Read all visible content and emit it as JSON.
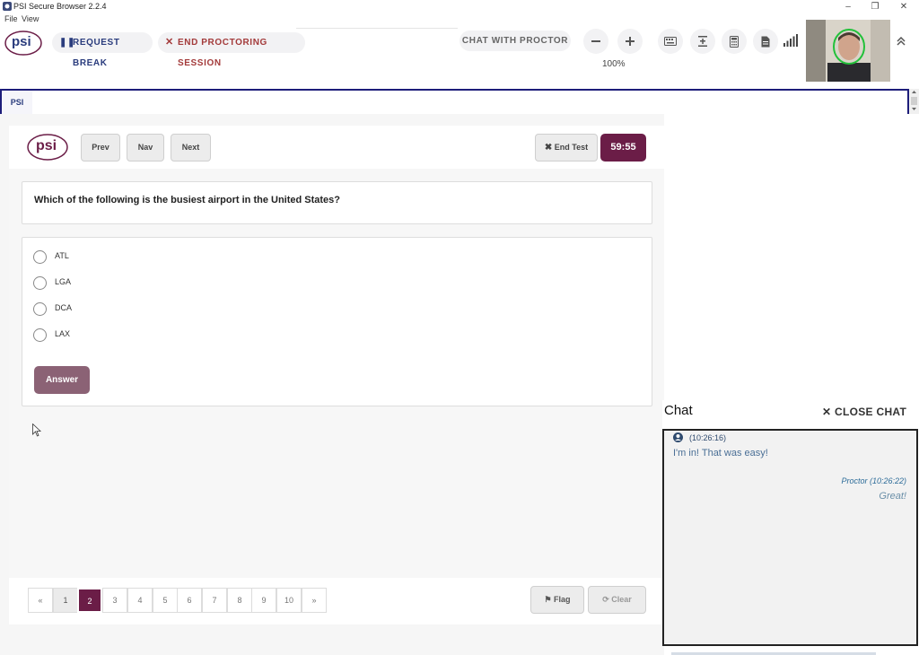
{
  "window": {
    "title": "PSI Secure Browser 2.2.4"
  },
  "menu": [
    "File",
    "View"
  ],
  "toolbar": {
    "logo": "psi",
    "request_break": "REQUEST BREAK",
    "end_session": "END PROCTORING SESSION",
    "chat_proctor": "CHAT WITH PROCTOR",
    "zoom": "100%",
    "icons": [
      "zoom-out-icon",
      "zoom-in-icon",
      "keyboard-icon",
      "text-height-icon",
      "calculator-icon",
      "document-icon",
      "signal-icon",
      "collapse-icon"
    ]
  },
  "tabs": {
    "active": "PSI"
  },
  "exam": {
    "logo": "psi",
    "prev": "Prev",
    "nav": "Nav",
    "next": "Next",
    "end_test": "End Test",
    "timer": "59:55",
    "question": "Which of the following is the busiest airport in the United States?",
    "options": [
      "ATL",
      "LGA",
      "DCA",
      "LAX"
    ],
    "answer_label": "Answer",
    "pagination": {
      "prev": "«",
      "next": "»",
      "pages": [
        "1",
        "2",
        "3",
        "4",
        "5",
        "6",
        "7",
        "8",
        "9",
        "10"
      ],
      "current": "2"
    },
    "flag": "Flag",
    "clear": "Clear"
  },
  "chat": {
    "title": "Chat",
    "close": "CLOSE CHAT",
    "messages": [
      {
        "time": "(10:26:16)",
        "text": "I'm in! That was easy!"
      },
      {
        "time": "Proctor (10:26:22)",
        "text": "Great!"
      }
    ]
  },
  "colors": {
    "brand": "#6b1d47",
    "accent_blue": "#2a3c7d",
    "end_session_red": "#a33a3a"
  }
}
